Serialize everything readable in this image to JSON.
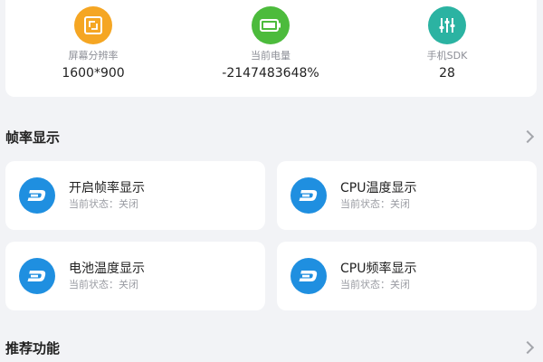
{
  "device_info": {
    "items": [
      {
        "label": "屏幕分辨率",
        "value": "1600*900",
        "icon": "screen-resolution-icon",
        "color": "#f5a623"
      },
      {
        "label": "当前电量",
        "value": "-2147483648%",
        "icon": "battery-icon",
        "color": "#4cbb3c"
      },
      {
        "label": "手机SDK",
        "value": "28",
        "icon": "sliders-icon",
        "color": "#2bb3a2"
      }
    ]
  },
  "framerate_section": {
    "title": "帧率显示",
    "cards": [
      {
        "title": "开启帧率显示",
        "status": "当前状态：关闭",
        "icon": "dash-icon"
      },
      {
        "title": "CPU温度显示",
        "status": "当前状态：关闭",
        "icon": "dash-icon"
      },
      {
        "title": "电池温度显示",
        "status": "当前状态：关闭",
        "icon": "dash-icon"
      },
      {
        "title": "CPU频率显示",
        "status": "当前状态：关闭",
        "icon": "dash-icon"
      }
    ]
  },
  "recommend_section": {
    "title": "推荐功能"
  },
  "colors": {
    "accent_blue": "#1f8fe0",
    "background": "#f2f3f6"
  }
}
